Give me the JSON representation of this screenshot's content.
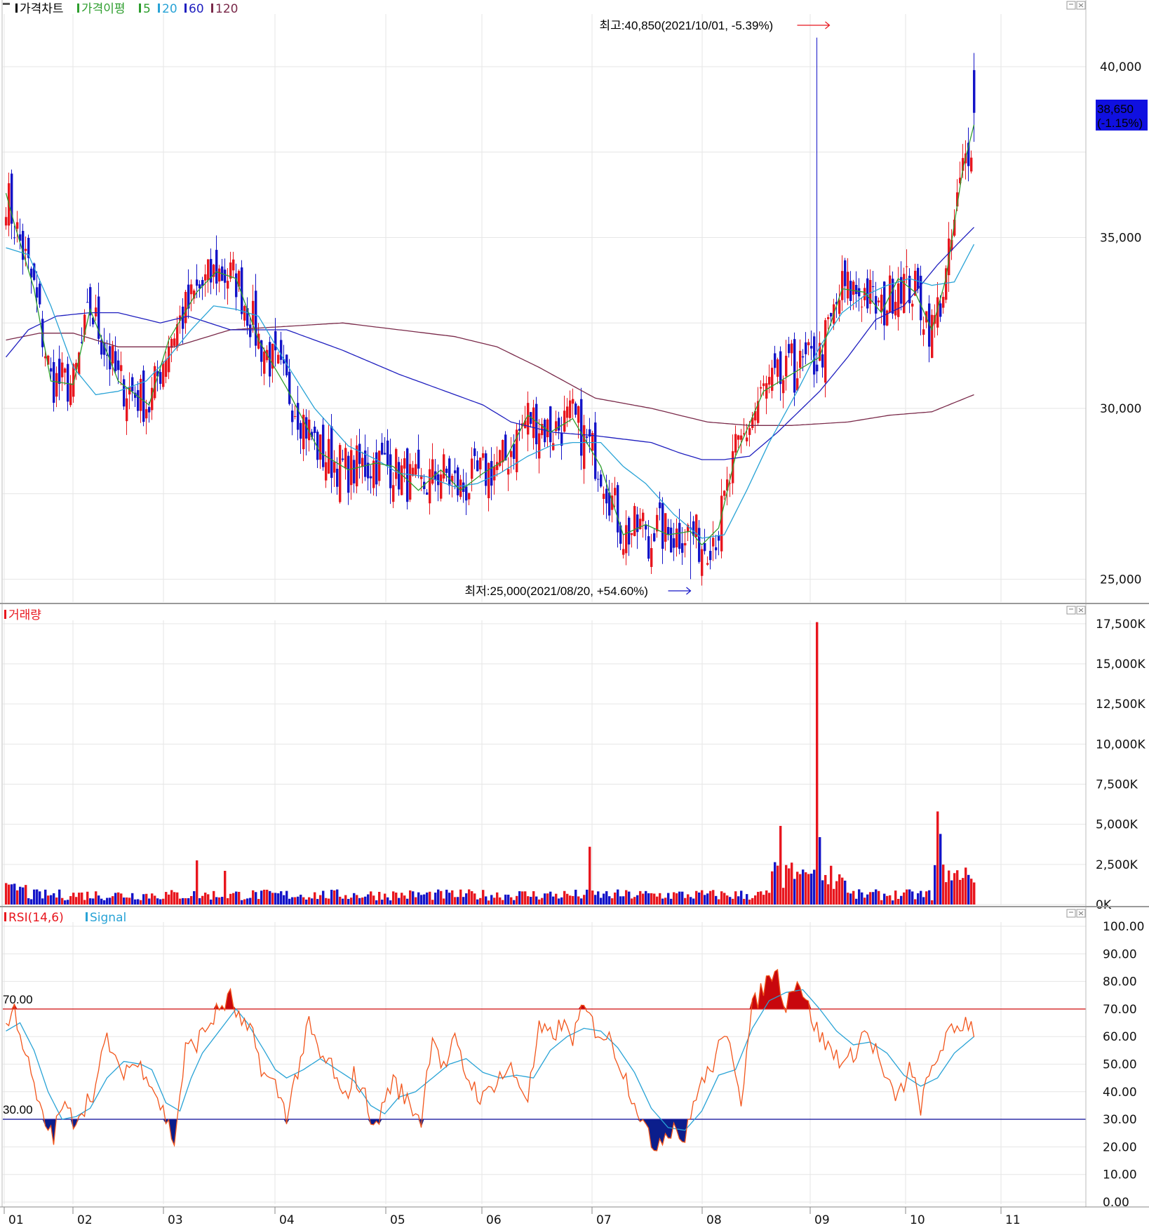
{
  "chart_data": [
    {
      "panel": "price",
      "type": "candlestick",
      "legend": [
        {
          "text": "가격차트",
          "color": "#000000"
        },
        {
          "text": "가격이평",
          "color": "#2e9e2e"
        },
        {
          "text": "5",
          "color": "#2e9e2e"
        },
        {
          "text": "20",
          "color": "#29a3d6"
        },
        {
          "text": "60",
          "color": "#1f1fbf"
        },
        {
          "text": "120",
          "color": "#7a2a4a"
        }
      ],
      "y_ticks": [
        25000,
        30000,
        35000,
        40000
      ],
      "y_tick_labels": [
        "25,000",
        "30,000",
        "35,000",
        "40,000"
      ],
      "ylim": [
        24700,
        41500
      ],
      "x_tick_labels": [
        "01",
        "02",
        "03",
        "04",
        "05",
        "06",
        "07",
        "08",
        "09",
        "10",
        "11"
      ],
      "current_price": "38,650",
      "current_change": "(-1.15%)",
      "high_annotation": "최고:40,850(2021/10/01, -5.39%)",
      "low_annotation": "최저:25,000(2021/08/20, +54.60%)",
      "up_color": "#e8161e",
      "down_color": "#1414c8",
      "ma_anchors": {
        "ma5": [
          [
            0,
            36300
          ],
          [
            3,
            35400
          ],
          [
            10,
            33500
          ],
          [
            16,
            30800
          ],
          [
            24,
            30700
          ],
          [
            30,
            32900
          ],
          [
            40,
            30800
          ],
          [
            51,
            30100
          ],
          [
            58,
            32000
          ],
          [
            68,
            33400
          ],
          [
            75,
            34000
          ],
          [
            82,
            33800
          ],
          [
            90,
            32000
          ],
          [
            100,
            30600
          ],
          [
            112,
            28700
          ],
          [
            122,
            28200
          ],
          [
            132,
            28400
          ],
          [
            138,
            28300
          ],
          [
            147,
            27600
          ],
          [
            155,
            28200
          ],
          [
            162,
            27600
          ],
          [
            170,
            28100
          ],
          [
            178,
            28500
          ],
          [
            186,
            29800
          ],
          [
            194,
            29300
          ],
          [
            202,
            29700
          ],
          [
            212,
            28300
          ],
          [
            220,
            26300
          ],
          [
            228,
            26600
          ],
          [
            236,
            26300
          ],
          [
            244,
            26400
          ],
          [
            248,
            26000
          ],
          [
            254,
            26500
          ],
          [
            260,
            28600
          ],
          [
            270,
            30500
          ],
          [
            280,
            31000
          ],
          [
            290,
            31500
          ],
          [
            298,
            33500
          ],
          [
            306,
            33400
          ],
          [
            312,
            32800
          ],
          [
            318,
            33800
          ],
          [
            324,
            33400
          ],
          [
            330,
            32300
          ],
          [
            335,
            33800
          ],
          [
            341,
            37000
          ],
          [
            345,
            38300
          ]
        ],
        "ma20": [
          [
            0,
            34700
          ],
          [
            8,
            34500
          ],
          [
            16,
            33000
          ],
          [
            24,
            31200
          ],
          [
            32,
            30400
          ],
          [
            40,
            30500
          ],
          [
            50,
            30800
          ],
          [
            58,
            31500
          ],
          [
            66,
            32300
          ],
          [
            74,
            33000
          ],
          [
            82,
            32900
          ],
          [
            90,
            32700
          ],
          [
            100,
            31300
          ],
          [
            110,
            30000
          ],
          [
            122,
            28900
          ],
          [
            132,
            28500
          ],
          [
            140,
            28100
          ],
          [
            150,
            28000
          ],
          [
            160,
            27700
          ],
          [
            168,
            27800
          ],
          [
            176,
            28100
          ],
          [
            186,
            28600
          ],
          [
            194,
            28900
          ],
          [
            202,
            29000
          ],
          [
            212,
            29000
          ],
          [
            220,
            28300
          ],
          [
            228,
            27800
          ],
          [
            238,
            26900
          ],
          [
            248,
            26200
          ],
          [
            256,
            26300
          ],
          [
            264,
            27600
          ],
          [
            272,
            29000
          ],
          [
            282,
            30500
          ],
          [
            290,
            31800
          ],
          [
            298,
            32800
          ],
          [
            306,
            33300
          ],
          [
            314,
            33600
          ],
          [
            322,
            33800
          ],
          [
            330,
            33600
          ],
          [
            338,
            33700
          ],
          [
            345,
            34800
          ]
        ],
        "ma60": [
          [
            0,
            31500
          ],
          [
            8,
            32300
          ],
          [
            18,
            32700
          ],
          [
            30,
            32800
          ],
          [
            40,
            32800
          ],
          [
            55,
            32500
          ],
          [
            65,
            32700
          ],
          [
            80,
            32300
          ],
          [
            100,
            32300
          ],
          [
            120,
            31700
          ],
          [
            140,
            31000
          ],
          [
            160,
            30400
          ],
          [
            170,
            30100
          ],
          [
            180,
            29600
          ],
          [
            195,
            29300
          ],
          [
            210,
            29200
          ],
          [
            230,
            29000
          ],
          [
            240,
            28700
          ],
          [
            248,
            28500
          ],
          [
            256,
            28500
          ],
          [
            265,
            28600
          ],
          [
            275,
            29300
          ],
          [
            290,
            30500
          ],
          [
            300,
            31500
          ],
          [
            310,
            32600
          ],
          [
            320,
            33000
          ],
          [
            332,
            34200
          ],
          [
            339,
            34800
          ],
          [
            345,
            35300
          ]
        ],
        "ma120": [
          [
            0,
            32000
          ],
          [
            12,
            32200
          ],
          [
            24,
            32200
          ],
          [
            40,
            31800
          ],
          [
            60,
            31800
          ],
          [
            80,
            32300
          ],
          [
            100,
            32400
          ],
          [
            120,
            32500
          ],
          [
            140,
            32300
          ],
          [
            160,
            32100
          ],
          [
            175,
            31800
          ],
          [
            190,
            31200
          ],
          [
            210,
            30300
          ],
          [
            230,
            30000
          ],
          [
            250,
            29600
          ],
          [
            265,
            29500
          ],
          [
            280,
            29500
          ],
          [
            300,
            29600
          ],
          [
            315,
            29800
          ],
          [
            330,
            29900
          ],
          [
            345,
            30400
          ]
        ]
      }
    },
    {
      "panel": "volume",
      "type": "bar",
      "legend": "거래량",
      "y_ticks": [
        0,
        2500,
        5000,
        7500,
        10000,
        12500,
        15000,
        17500
      ],
      "y_tick_labels": [
        "0K",
        "2,500K",
        "5,000K",
        "7,500K",
        "10,000K",
        "12,500K",
        "15,000K",
        "17,500K"
      ],
      "ylim": [
        0,
        17800
      ],
      "notable_bars": [
        {
          "month": "03",
          "value": 2750,
          "color": "up"
        },
        {
          "month": "03",
          "value": 2100,
          "color": "up"
        },
        {
          "month": "07",
          "value": 3600,
          "color": "up"
        },
        {
          "month": "09",
          "value": 4900,
          "color": "up"
        },
        {
          "month": "10",
          "value": 17600,
          "color": "up"
        },
        {
          "month": "10",
          "value": 4200,
          "color": "down"
        },
        {
          "month": "11",
          "value": 5800,
          "color": "up"
        },
        {
          "month": "11",
          "value": 4400,
          "color": "down"
        }
      ]
    },
    {
      "panel": "rsi",
      "type": "line",
      "legend": [
        {
          "text": "RSI(14,6)",
          "color": "#e8161e"
        },
        {
          "text": "Signal",
          "color": "#29a3d6"
        }
      ],
      "y_ticks": [
        0,
        10,
        20,
        30,
        40,
        50,
        60,
        70,
        80,
        90,
        100
      ],
      "y_tick_labels": [
        "0.00",
        "10.00",
        "20.00",
        "30.00",
        "40.00",
        "50.00",
        "60.00",
        "70.00",
        "80.00",
        "90.00",
        "100.00"
      ],
      "upper_level": 70,
      "lower_level": 30,
      "upper_label": "70.00",
      "lower_label": "30.00",
      "ylim": [
        0,
        102
      ],
      "rsi_anchors": [
        [
          0,
          63
        ],
        [
          3,
          70
        ],
        [
          6,
          58
        ],
        [
          9,
          45
        ],
        [
          13,
          30
        ],
        [
          17,
          24
        ],
        [
          20,
          35
        ],
        [
          24,
          30
        ],
        [
          28,
          35
        ],
        [
          32,
          42
        ],
        [
          36,
          60
        ],
        [
          40,
          47
        ],
        [
          45,
          50
        ],
        [
          50,
          48
        ],
        [
          56,
          33
        ],
        [
          60,
          22
        ],
        [
          64,
          55
        ],
        [
          68,
          58
        ],
        [
          72,
          64
        ],
        [
          76,
          70
        ],
        [
          80,
          74
        ],
        [
          84,
          64
        ],
        [
          88,
          60
        ],
        [
          92,
          46
        ],
        [
          96,
          42
        ],
        [
          100,
          32
        ],
        [
          104,
          48
        ],
        [
          108,
          64
        ],
        [
          112,
          52
        ],
        [
          116,
          50
        ],
        [
          120,
          36
        ],
        [
          124,
          46
        ],
        [
          128,
          38
        ],
        [
          132,
          26
        ],
        [
          135,
          38
        ],
        [
          138,
          44
        ],
        [
          142,
          38
        ],
        [
          148,
          30
        ],
        [
          152,
          62
        ],
        [
          156,
          48
        ],
        [
          160,
          58
        ],
        [
          164,
          46
        ],
        [
          170,
          37
        ],
        [
          175,
          45
        ],
        [
          180,
          48
        ],
        [
          186,
          38
        ],
        [
          190,
          62
        ],
        [
          194,
          60
        ],
        [
          198,
          64
        ],
        [
          202,
          60
        ],
        [
          206,
          70
        ],
        [
          210,
          63
        ],
        [
          216,
          58
        ],
        [
          222,
          42
        ],
        [
          226,
          32
        ],
        [
          230,
          20
        ],
        [
          234,
          24
        ],
        [
          238,
          28
        ],
        [
          242,
          22
        ],
        [
          246,
          40
        ],
        [
          250,
          46
        ],
        [
          254,
          55
        ],
        [
          258,
          60
        ],
        [
          262,
          38
        ],
        [
          266,
          70
        ],
        [
          270,
          78
        ],
        [
          274,
          85
        ],
        [
          278,
          72
        ],
        [
          282,
          82
        ],
        [
          286,
          70
        ],
        [
          290,
          60
        ],
        [
          294,
          55
        ],
        [
          300,
          50
        ],
        [
          306,
          62
        ],
        [
          310,
          55
        ],
        [
          314,
          42
        ],
        [
          318,
          38
        ],
        [
          322,
          48
        ],
        [
          326,
          35
        ],
        [
          330,
          48
        ],
        [
          334,
          58
        ],
        [
          338,
          62
        ],
        [
          342,
          66
        ],
        [
          345,
          63
        ]
      ],
      "signal_anchors": [
        [
          0,
          62
        ],
        [
          5,
          65
        ],
        [
          10,
          55
        ],
        [
          15,
          40
        ],
        [
          20,
          30
        ],
        [
          25,
          31
        ],
        [
          30,
          34
        ],
        [
          36,
          45
        ],
        [
          42,
          51
        ],
        [
          48,
          50
        ],
        [
          52,
          48
        ],
        [
          57,
          36
        ],
        [
          62,
          33
        ],
        [
          66,
          45
        ],
        [
          70,
          54
        ],
        [
          76,
          62
        ],
        [
          82,
          70
        ],
        [
          86,
          65
        ],
        [
          92,
          55
        ],
        [
          96,
          48
        ],
        [
          100,
          45
        ],
        [
          106,
          48
        ],
        [
          112,
          52
        ],
        [
          118,
          48
        ],
        [
          124,
          44
        ],
        [
          130,
          35
        ],
        [
          135,
          32
        ],
        [
          140,
          38
        ],
        [
          146,
          40
        ],
        [
          152,
          45
        ],
        [
          158,
          50
        ],
        [
          164,
          52
        ],
        [
          170,
          47
        ],
        [
          176,
          45
        ],
        [
          182,
          46
        ],
        [
          188,
          45
        ],
        [
          194,
          55
        ],
        [
          200,
          60
        ],
        [
          206,
          63
        ],
        [
          212,
          62
        ],
        [
          218,
          56
        ],
        [
          224,
          47
        ],
        [
          230,
          34
        ],
        [
          236,
          27
        ],
        [
          242,
          26
        ],
        [
          248,
          33
        ],
        [
          254,
          46
        ],
        [
          260,
          48
        ],
        [
          266,
          63
        ],
        [
          272,
          73
        ],
        [
          278,
          76
        ],
        [
          284,
          77
        ],
        [
          290,
          70
        ],
        [
          296,
          62
        ],
        [
          302,
          57
        ],
        [
          308,
          58
        ],
        [
          314,
          54
        ],
        [
          320,
          46
        ],
        [
          326,
          42
        ],
        [
          332,
          45
        ],
        [
          338,
          54
        ],
        [
          345,
          60
        ]
      ]
    }
  ]
}
